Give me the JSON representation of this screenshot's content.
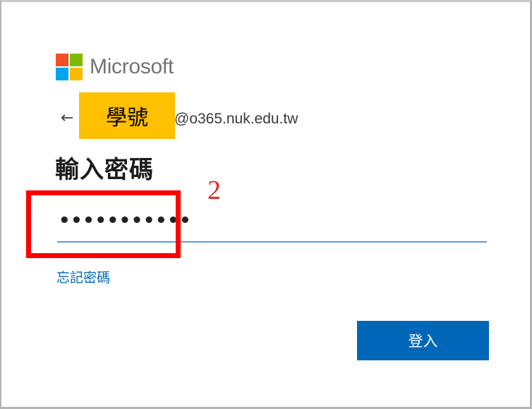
{
  "brand": {
    "name": "Microsoft",
    "colors": {
      "red": "#f25022",
      "green": "#7fba00",
      "blue": "#00a4ef",
      "yellow": "#ffb900"
    }
  },
  "identity": {
    "back_icon": "←",
    "masked_id_label": "學號",
    "email_domain": "@o365.nuk.edu.tw"
  },
  "heading": "輸入密碼",
  "annotation": {
    "step_number": "2",
    "color": "#ff0000"
  },
  "password": {
    "masked_value": "•••••••••••"
  },
  "forgot_password_link": "忘記密碼",
  "signin_button": {
    "label": "登入",
    "color": "#0067b8"
  }
}
